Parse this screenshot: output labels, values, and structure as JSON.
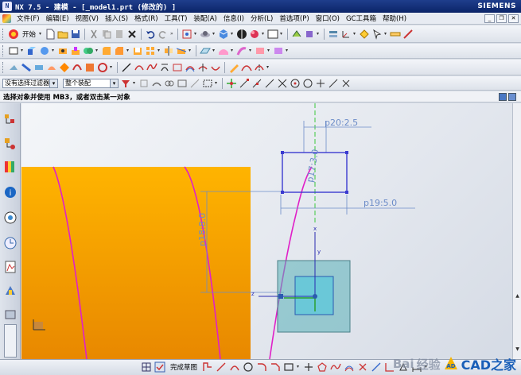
{
  "window": {
    "title": "NX 7.5 - 建模 - [_model1.prt  (修改的) ]",
    "brand": "SIEMENS",
    "buttons": [
      "minimize",
      "maximize",
      "close"
    ]
  },
  "menu": {
    "items": [
      "文件(F)",
      "编辑(E)",
      "视图(V)",
      "插入(S)",
      "格式(R)",
      "工具(T)",
      "装配(A)",
      "信息(I)",
      "分析(L)",
      "首选项(P)",
      "窗口(O)",
      "GC工具箱",
      "帮助(H)"
    ]
  },
  "toolbar1": {
    "start_label": "开始"
  },
  "filter": {
    "selection_filter": "没有选择过滤器",
    "scope": "整个装配"
  },
  "cue": {
    "text": "选择对象并使用 MB3，或者双击某一对象"
  },
  "sketch": {
    "dimensions": [
      "p20:2.5",
      "p19:5.0",
      "p18:8.0",
      "p17:3.0"
    ],
    "axis_labels": [
      "x",
      "y",
      "z"
    ],
    "colors": {
      "solid_top": "#ffb400",
      "solid_bottom": "#e88800",
      "curve": "#e020c8",
      "dimension": "#6c8cc8",
      "centerline": "#3cc83c",
      "datum_square": "#5ab0b8"
    }
  },
  "bottom_toolbar": {
    "finish_label": "完成草图"
  },
  "watermark": {
    "text1": "Bai",
    "text2": "经验",
    "brand": "CAD之家"
  }
}
